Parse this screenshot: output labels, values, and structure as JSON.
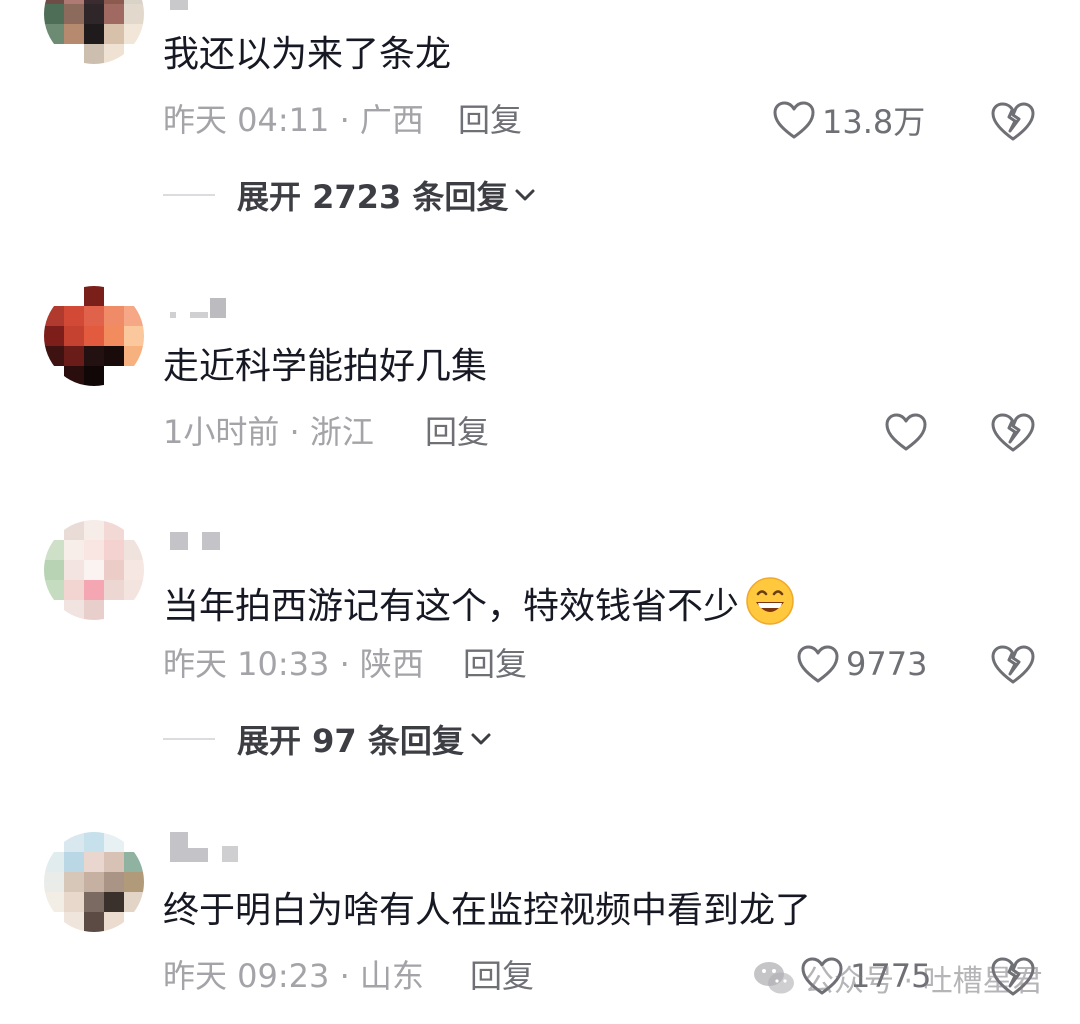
{
  "comments": [
    {
      "text": "我还以为来了条龙",
      "time_location": "昨天 04:11 · 广西",
      "reply_label": "回复",
      "likes": "13.8万",
      "expand_label": "展开 2723 条回复"
    },
    {
      "text": "走近科学能拍好几集",
      "time_location": "1小时前 · 浙江",
      "reply_label": "回复",
      "likes": "",
      "expand_label": ""
    },
    {
      "text": "当年拍西游记有这个，特效钱省不少",
      "emoji": "grinning-face-emoji",
      "time_location": "昨天 10:33 · 陕西",
      "reply_label": "回复",
      "likes": "9773",
      "expand_label": "展开 97 条回复"
    },
    {
      "text": "终于明白为啥有人在监控视频中看到龙了",
      "time_location": "昨天 09:23 · 山东",
      "reply_label": "回复",
      "likes": "1775",
      "expand_label": ""
    }
  ],
  "icons": {
    "like": "heart-outline-icon",
    "dislike": "broken-heart-icon",
    "expand": "chevron-down-icon",
    "watermark": "wechat-icon"
  },
  "watermark": {
    "text": "公众号 · 吐槽星君"
  },
  "colors": {
    "text": "#161823",
    "meta": "#a3a3a8",
    "action": "#6f7075"
  }
}
